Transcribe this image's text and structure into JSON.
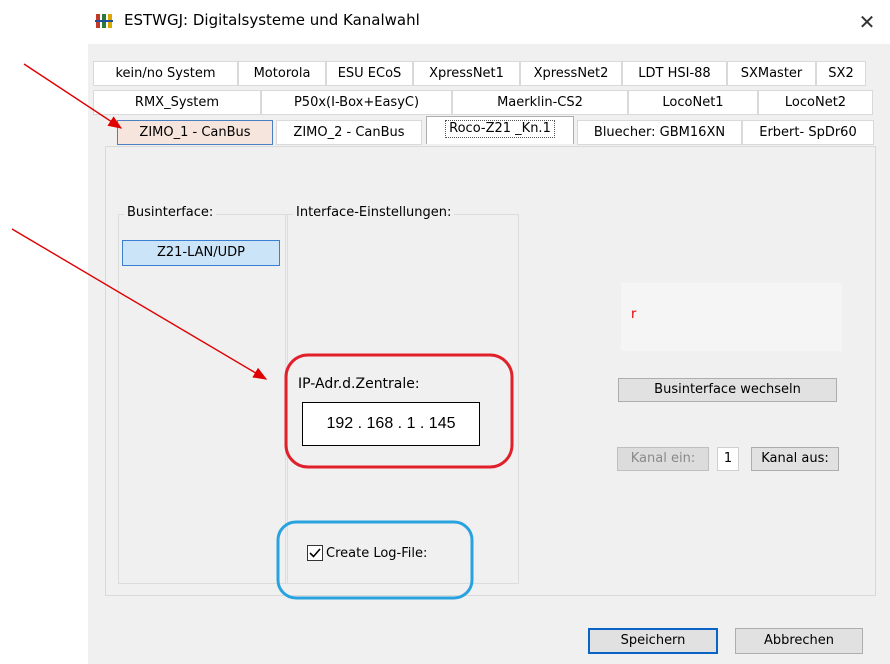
{
  "window": {
    "title": "ESTWGJ: Digitalsysteme und Kanalwahl",
    "close_glyph": "✕"
  },
  "tabs": {
    "row1": [
      "kein/no System",
      "Motorola",
      "ESU ECoS",
      "XpressNet1",
      "XpressNet2",
      "LDT HSI-88",
      "SXMaster",
      "SX2"
    ],
    "row2": [
      "RMX_System",
      "P50x(I-Box+EasyC)",
      "Maerklin-CS2",
      "LocoNet1",
      "LocoNet2"
    ],
    "row3": [
      "ZIMO_1 - CanBus",
      "ZIMO_2 - CanBus",
      "Roco-Z21 _Kn.1",
      "Bluecher: GBM16XN",
      "Erbert- SpDr60"
    ],
    "selected": "Roco-Z21 _Kn.1"
  },
  "busint": {
    "label": "Businterface:",
    "button": "Z21-LAN/UDP"
  },
  "settings": {
    "label": "Interface-Einstellungen:",
    "ip_label": "IP-Adr.d.Zentrale:",
    "ip_value": "192 . 168 . 1 . 145",
    "log_label": "Create Log-File:",
    "log_checked": true
  },
  "right": {
    "red_glyph": "r",
    "switch_button": "Businterface wechseln",
    "kanal_ein": "Kanal ein:",
    "kanal_value": "1",
    "kanal_aus": "Kanal aus:"
  },
  "footer": {
    "save": "Speichern",
    "cancel": "Abbrechen"
  },
  "colors": {
    "arrow": "#e00000",
    "red_outline": "#e0202a",
    "blue_outline": "#29a3e0",
    "highlight_tab": "#f6e5dc"
  }
}
